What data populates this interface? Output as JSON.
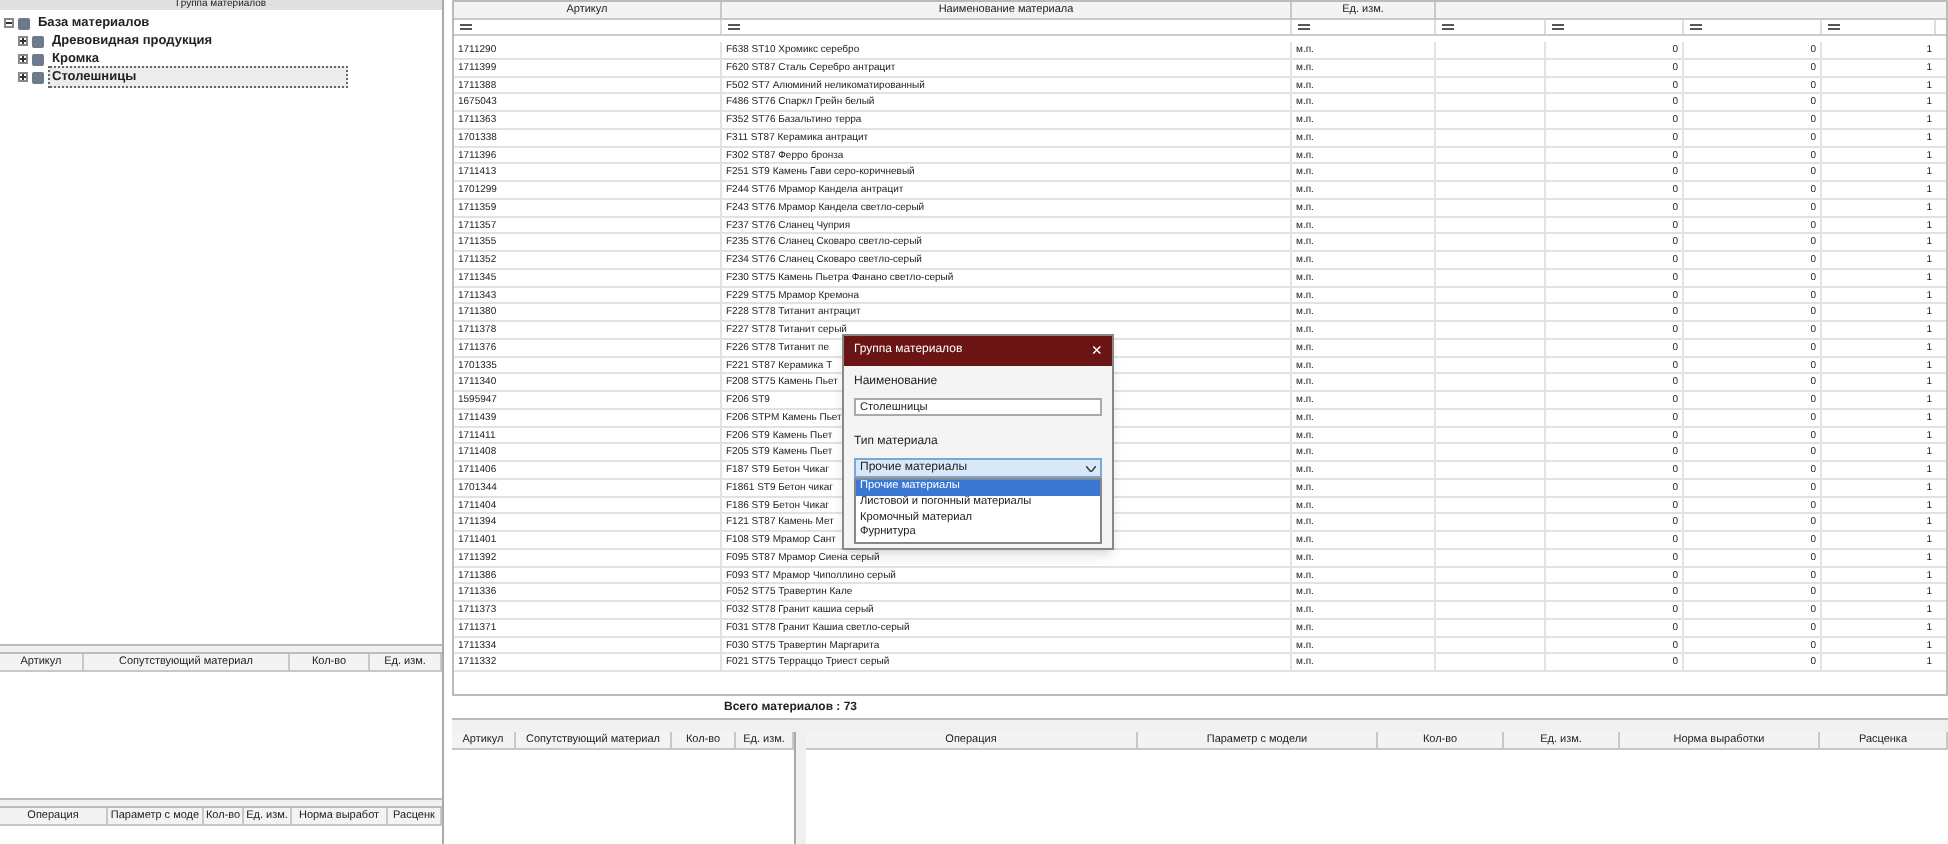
{
  "materials_panel": {
    "title": "Группа материалов",
    "tree": [
      {
        "label": "База материалов",
        "expanded": true,
        "selected": false,
        "children": [
          {
            "label": "Древовидная продукция",
            "expanded": false,
            "selected": false
          },
          {
            "label": "Кромка",
            "expanded": false,
            "selected": false
          },
          {
            "label": "Столешницы",
            "expanded": false,
            "selected": true
          }
        ]
      }
    ]
  },
  "left_related_table": {
    "columns": [
      "Артикул",
      "Сопутствующий материал",
      "Кол-во",
      "Ед. изм."
    ]
  },
  "left_operations_table": {
    "columns": [
      "Операция",
      "Параметр с моде",
      "Кол-во",
      "Ед. изм.",
      "Норма выработ",
      "Расценк"
    ]
  },
  "materials_table": {
    "columns": [
      "Артикул",
      "Наименование материала",
      "Ед. изм."
    ],
    "rows": [
      {
        "article": "1711290",
        "name": "F638 ST10 Хромикс серебро",
        "unit": "м.п.",
        "column_5": "0",
        "column_6": "0",
        "column_7": "1"
      },
      {
        "article": "1711399",
        "name": "F620 ST87 Сталь Серебро антрацит",
        "unit": "м.п.",
        "column_5": "0",
        "column_6": "0",
        "column_7": "1"
      },
      {
        "article": "1711388",
        "name": "F502 ST7 Алюминий неликоматированный",
        "unit": "м.п.",
        "column_5": "0",
        "column_6": "0",
        "column_7": "1"
      },
      {
        "article": "1675043",
        "name": "F486 ST76 Спаркл Грейн белый",
        "unit": "м.п.",
        "column_5": "0",
        "column_6": "0",
        "column_7": "1"
      },
      {
        "article": "1711363",
        "name": "F352 ST76 Базальтино терра",
        "unit": "м.п.",
        "column_5": "0",
        "column_6": "0",
        "column_7": "1"
      },
      {
        "article": "1701338",
        "name": "F311 ST87 Керамика антрацит",
        "unit": "м.п.",
        "column_5": "0",
        "column_6": "0",
        "column_7": "1"
      },
      {
        "article": "1711396",
        "name": "F302 ST87 Ферро бронза",
        "unit": "м.п.",
        "column_5": "0",
        "column_6": "0",
        "column_7": "1"
      },
      {
        "article": "1711413",
        "name": "F251 ST9 Камень Гави серо-коричневый",
        "unit": "м.п.",
        "column_5": "0",
        "column_6": "0",
        "column_7": "1"
      },
      {
        "article": "1701299",
        "name": "F244 ST76 Мрамор Кандела антрацит",
        "unit": "м.п.",
        "column_5": "0",
        "column_6": "0",
        "column_7": "1"
      },
      {
        "article": "1711359",
        "name": "F243 ST76 Мрамор Кандела светло-серый",
        "unit": "м.п.",
        "column_5": "0",
        "column_6": "0",
        "column_7": "1"
      },
      {
        "article": "1711357",
        "name": "F237 ST76 Сланец Чуприя",
        "unit": "м.п.",
        "column_5": "0",
        "column_6": "0",
        "column_7": "1"
      },
      {
        "article": "1711355",
        "name": "F235 ST76 Сланец Сковаро светло-серый",
        "unit": "м.п.",
        "column_5": "0",
        "column_6": "0",
        "column_7": "1"
      },
      {
        "article": "1711352",
        "name": "F234 ST76 Сланец Сковаро светло-серый",
        "unit": "м.п.",
        "column_5": "0",
        "column_6": "0",
        "column_7": "1"
      },
      {
        "article": "1711345",
        "name": "F230 ST75 Камень Пьетра Фанано светло-серый",
        "unit": "м.п.",
        "column_5": "0",
        "column_6": "0",
        "column_7": "1"
      },
      {
        "article": "1711343",
        "name": "F229 ST75 Мрамор Кремона",
        "unit": "м.п.",
        "column_5": "0",
        "column_6": "0",
        "column_7": "1"
      },
      {
        "article": "1711380",
        "name": "F228 ST78 Титанит антрацит",
        "unit": "м.п.",
        "column_5": "0",
        "column_6": "0",
        "column_7": "1"
      },
      {
        "article": "1711378",
        "name": "F227 ST78 Титанит серый",
        "unit": "м.п.",
        "column_5": "0",
        "column_6": "0",
        "column_7": "1"
      },
      {
        "article": "1711376",
        "name": "F226 ST78 Титанит пе",
        "unit": "м.п.",
        "column_5": "0",
        "column_6": "0",
        "column_7": "1"
      },
      {
        "article": "1701335",
        "name": "F221 ST87 Керамика Т",
        "unit": "м.п.",
        "column_5": "0",
        "column_6": "0",
        "column_7": "1"
      },
      {
        "article": "1711340",
        "name": "F208 ST75 Камень Пьет",
        "unit": "м.п.",
        "column_5": "0",
        "column_6": "0",
        "column_7": "1"
      },
      {
        "article": "1595947",
        "name": "F206  ST9",
        "unit": "м.п.",
        "column_5": "0",
        "column_6": "0",
        "column_7": "1"
      },
      {
        "article": "1711439",
        "name": "F206 STPM Камень Пьет",
        "unit": "м.п.",
        "column_5": "0",
        "column_6": "0",
        "column_7": "1"
      },
      {
        "article": "1711411",
        "name": "F206 ST9 Камень Пьет",
        "unit": "м.п.",
        "column_5": "0",
        "column_6": "0",
        "column_7": "1"
      },
      {
        "article": "1711408",
        "name": "F205 ST9 Камень Пьет",
        "unit": "м.п.",
        "column_5": "0",
        "column_6": "0",
        "column_7": "1"
      },
      {
        "article": "1711406",
        "name": "F187 ST9 Бетон Чикаг",
        "unit": "м.п.",
        "column_5": "0",
        "column_6": "0",
        "column_7": "1"
      },
      {
        "article": "1701344",
        "name": "F1861 ST9 Бетон чикаг",
        "unit": "м.п.",
        "column_5": "0",
        "column_6": "0",
        "column_7": "1"
      },
      {
        "article": "1711404",
        "name": "F186 ST9 Бетон Чикаг",
        "unit": "м.п.",
        "column_5": "0",
        "column_6": "0",
        "column_7": "1"
      },
      {
        "article": "1711394",
        "name": "F121 ST87 Камень Мет",
        "unit": "м.п.",
        "column_5": "0",
        "column_6": "0",
        "column_7": "1"
      },
      {
        "article": "1711401",
        "name": "F108 ST9 Мрамор Сант",
        "unit": "м.п.",
        "column_5": "0",
        "column_6": "0",
        "column_7": "1"
      },
      {
        "article": "1711392",
        "name": "F095 ST87 Мрамор Сиена серый",
        "unit": "м.п.",
        "column_5": "0",
        "column_6": "0",
        "column_7": "1"
      },
      {
        "article": "1711386",
        "name": "F093 ST7 Мрамор Чиполлино серый",
        "unit": "м.п.",
        "column_5": "0",
        "column_6": "0",
        "column_7": "1"
      },
      {
        "article": "1711336",
        "name": "F052 ST75 Травертин Кале",
        "unit": "м.п.",
        "column_5": "0",
        "column_6": "0",
        "column_7": "1"
      },
      {
        "article": "1711373",
        "name": "F032 ST78 Гранит кашиа серый",
        "unit": "м.п.",
        "column_5": "0",
        "column_6": "0",
        "column_7": "1"
      },
      {
        "article": "1711371",
        "name": "F031 ST78 Гранит Кашиа светло-серый",
        "unit": "м.п.",
        "column_5": "0",
        "column_6": "0",
        "column_7": "1"
      },
      {
        "article": "1711334",
        "name": "F030 ST75 Травертин Маргарита",
        "unit": "м.п.",
        "column_5": "0",
        "column_6": "0",
        "column_7": "1"
      },
      {
        "article": "1711332",
        "name": "F021 ST75 Терраццо Триест серый",
        "unit": "м.п.",
        "column_5": "0",
        "column_6": "0",
        "column_7": "1"
      }
    ],
    "total": "Всего материалов : 73"
  },
  "bottom_related_table": {
    "columns": [
      "Артикул",
      "Сопутствующий материал",
      "Кол-во",
      "Ед. изм."
    ]
  },
  "bottom_operations_table": {
    "columns": [
      "Операция",
      "Параметр с модели",
      "Кол-во",
      "Ед. изм.",
      "Норма выработки",
      "Расценка"
    ]
  },
  "dialog": {
    "title": "Группа материалов",
    "close": "×",
    "name_label": "Наименование",
    "name_value": "Столешницы",
    "type_label": "Тип материала",
    "type_value": "Прочие материалы",
    "options": [
      {
        "label": "Прочие материалы",
        "selected": true
      },
      {
        "label": "Листовой и погонный материалы",
        "selected": false
      },
      {
        "label": "Кромочный материал",
        "selected": false
      },
      {
        "label": "Фурнитура",
        "selected": false
      }
    ]
  }
}
